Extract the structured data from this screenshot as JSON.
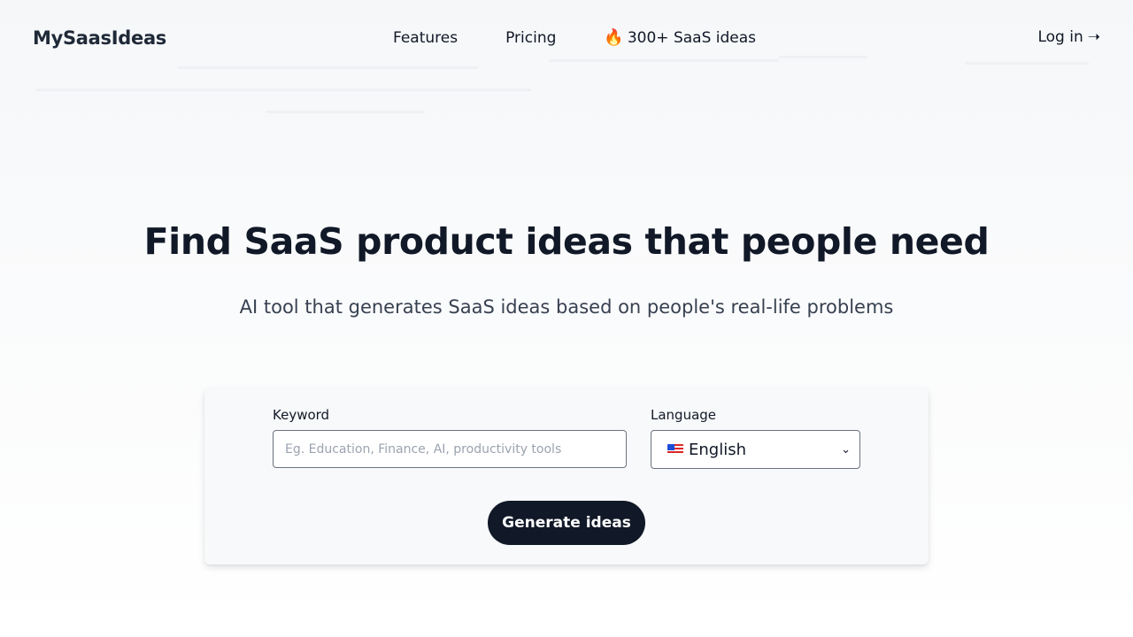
{
  "brand": {
    "name": "MySaasIdeas"
  },
  "nav": {
    "items": [
      {
        "label": "Features"
      },
      {
        "label": "Pricing"
      },
      {
        "label": "300+ SaaS ideas",
        "icon": "fire-icon"
      }
    ],
    "login_label": "Log in",
    "login_icon": "arrow-right-icon"
  },
  "hero": {
    "title": "Find SaaS product ideas that people need",
    "subtitle": "AI tool that generates SaaS ideas based on people's real-life problems"
  },
  "form": {
    "keyword_label": "Keyword",
    "keyword_placeholder": "Eg. Education, Finance, AI, productivity tools",
    "keyword_value": "",
    "language_label": "Language",
    "language_value": "English",
    "language_flag_icon": "us-flag-icon",
    "submit_label": "Generate ideas"
  },
  "colors": {
    "primary_button": "#111827",
    "text": "#111827",
    "subtext": "#374151",
    "card_bg": "#f8f9fb"
  }
}
